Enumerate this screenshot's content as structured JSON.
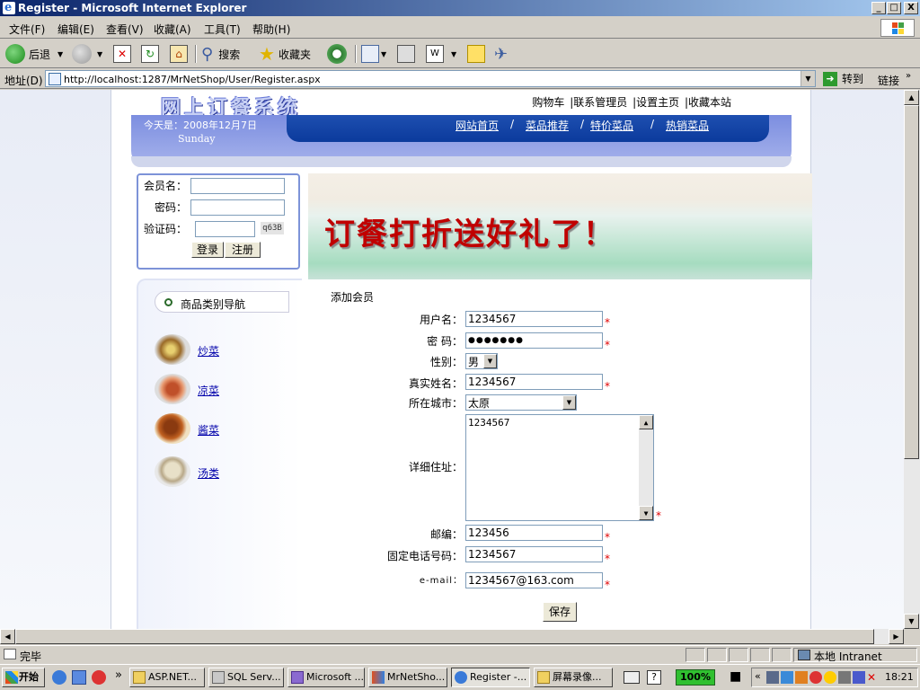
{
  "window": {
    "title": "Register - Microsoft Internet Explorer",
    "controls": [
      "_",
      "□",
      "X"
    ]
  },
  "menu": [
    "文件(F)",
    "编辑(E)",
    "查看(V)",
    "收藏(A)",
    "工具(T)",
    "帮助(H)"
  ],
  "toolbar": {
    "back": "后退",
    "search": "搜索",
    "favorites": "收藏夹"
  },
  "address": {
    "label": "地址(D)",
    "url": "http://localhost:1287/MrNetShop/User/Register.aspx",
    "go": "转到",
    "links": "链接"
  },
  "site": {
    "logo": "网上订餐系统",
    "top_links": [
      "购物车",
      "|联系管理员",
      "|设置主页",
      "|收藏本站"
    ],
    "date_line": "今天是：2008年12月7日",
    "weekday": "Sunday",
    "nav": [
      "网站首页",
      "/",
      "菜品推荐",
      "/",
      "特价菜品",
      "/",
      "热销菜品"
    ]
  },
  "login": {
    "user_label": "会员名：",
    "pwd_label": "密码：",
    "code_label": "验证码：",
    "captcha": "q63B",
    "login_btn": "登录",
    "register_btn": "注册"
  },
  "categories": {
    "title": "商品类别导航",
    "items": [
      "炒菜",
      "凉菜",
      "酱菜",
      "汤类"
    ]
  },
  "banner": {
    "text": "订餐打折送好礼了！"
  },
  "form": {
    "title": "添加会员",
    "username_label": "用户名：",
    "username": "1234567",
    "password_label": "密 码：",
    "password": "●●●●●●●",
    "gender_label": "性别：",
    "gender": "男",
    "realname_label": "真实姓名：",
    "realname": "1234567",
    "city_label": "所在城市：",
    "city": "太原",
    "address_label": "详细住址：",
    "address": "1234567",
    "zip_label": "邮编：",
    "zip": "123456",
    "phone_label": "固定电话号码：",
    "phone": "1234567",
    "email_label": "e-mail：",
    "email": "1234567@163.com",
    "required": "*",
    "save": "保存"
  },
  "status": {
    "text": "完毕",
    "zone": "本地 Intranet"
  },
  "taskbar": {
    "start": "开始",
    "buttons": [
      "ASP.NET...",
      "SQL Serv...",
      "Microsoft ...",
      "MrNetSho...",
      "Register -...",
      "屏幕录像..."
    ],
    "zoom": "100%",
    "clock": "18:21"
  }
}
